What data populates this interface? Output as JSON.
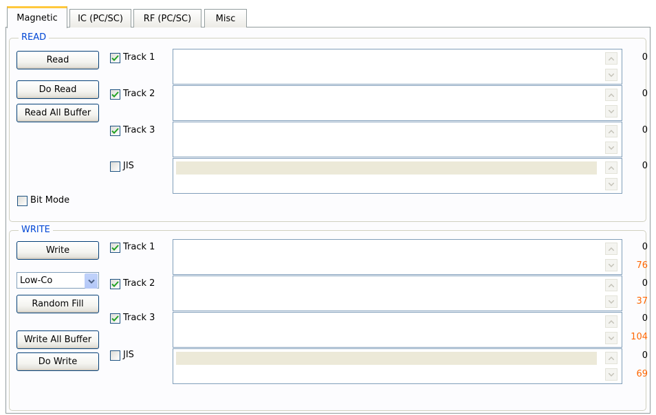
{
  "tabs": [
    "Magnetic",
    "IC (PC/SC)",
    "RF (PC/SC)",
    "Misc"
  ],
  "read": {
    "title": "READ",
    "buttons": {
      "read": "Read",
      "do_read": "Do Read",
      "read_all_buffer": "Read All Buffer"
    },
    "tracks": [
      {
        "label": "Track 1",
        "checked": true,
        "count": "0"
      },
      {
        "label": "Track 2",
        "checked": true,
        "count": "0"
      },
      {
        "label": "Track 3",
        "checked": true,
        "count": "0"
      },
      {
        "label": "JIS",
        "checked": false,
        "count": "0"
      }
    ],
    "bit_mode": {
      "label": "Bit Mode",
      "checked": false
    }
  },
  "write": {
    "title": "WRITE",
    "buttons": {
      "write": "Write",
      "random_fill": "Random Fill",
      "write_all_buffer": "Write All Buffer",
      "do_write": "Do Write"
    },
    "coercivity": "Low-Co",
    "tracks": [
      {
        "label": "Track 1",
        "checked": true,
        "count": "0",
        "max": "76"
      },
      {
        "label": "Track 2",
        "checked": true,
        "count": "0",
        "max": "37"
      },
      {
        "label": "Track 3",
        "checked": true,
        "count": "0",
        "max": "104"
      },
      {
        "label": "JIS",
        "checked": false,
        "count": "0",
        "max": "69"
      }
    ]
  },
  "colors": {
    "group_title": "#0046d5",
    "max_count": "#ff6600",
    "tab_highlight": "#ffc83c"
  },
  "icons": {
    "check": "checkmark-icon",
    "scroll_up": "scroll-up-icon",
    "scroll_down": "scroll-down-icon",
    "dropdown": "chevron-down-icon"
  }
}
